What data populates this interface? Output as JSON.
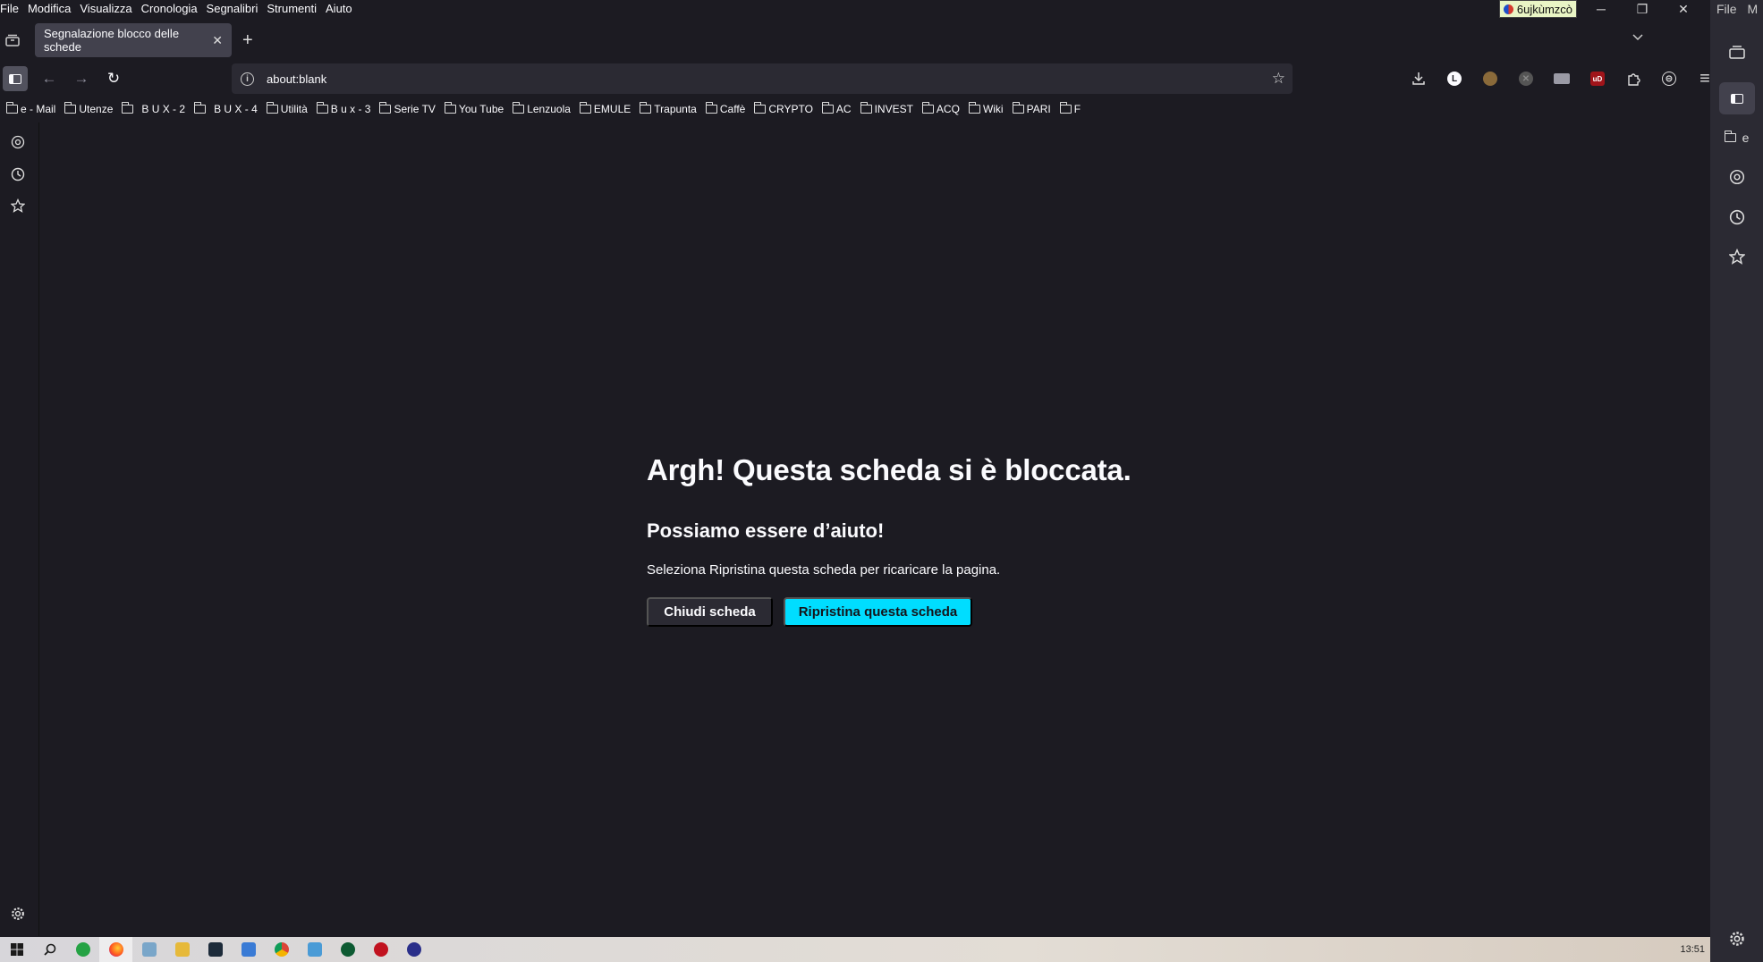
{
  "menubar": {
    "items": [
      "File",
      "Modifica",
      "Visualizza",
      "Cronologia",
      "Segnalibri",
      "Strumenti",
      "Aiuto"
    ]
  },
  "window": {
    "profile_label": "6ujkùmzcò",
    "minimize": "─",
    "restore": "❐",
    "close": "✕"
  },
  "tabs": {
    "active_tab_title": "Segnalazione blocco delle schede",
    "close_glyph": "✕",
    "new_tab_glyph": "+",
    "list_glyph": "⌄"
  },
  "toolbar": {
    "url": "about:blank",
    "back": "←",
    "forward": "→",
    "reload": "↻",
    "star": "☆",
    "download": "⤓",
    "menu": "≡",
    "extension_L": "L",
    "extension_ub": "uD"
  },
  "bookmarks": [
    "e - Mail",
    "Utenze",
    "B U X - 2",
    "B U X - 4",
    "Utilità",
    "B u x - 3",
    "Serie TV",
    "You Tube",
    "Lenzuola",
    "EMULE",
    "Trapunta",
    "Caffè",
    "CRYPTO",
    "AC",
    "INVEST",
    "ACQ",
    "Wiki",
    "PARI",
    "F"
  ],
  "right_sidebar": {
    "menu_file": "File",
    "menu_m": "M",
    "folder_label": "e"
  },
  "crash": {
    "title": "Argh! Questa scheda si è bloccata.",
    "subtitle": "Possiamo essere d’aiuto!",
    "message": "Seleziona Ripristina questa scheda per ricaricare la pagina.",
    "close_button": "Chiudi scheda",
    "restore_button": "Ripristina questa scheda"
  },
  "taskbar": {
    "time": "13:51"
  },
  "colors": {
    "background": "#1c1b22",
    "accent": "#00ddff"
  }
}
